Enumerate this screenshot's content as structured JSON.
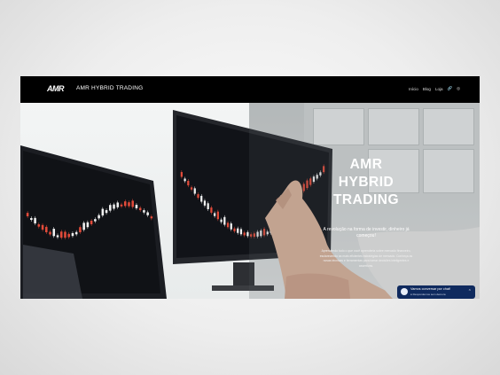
{
  "header": {
    "logo_text": "AMR",
    "site_title": "AMR HYBRID TRADING",
    "nav_items": [
      "Início",
      "Blog",
      "Loja"
    ],
    "nav_icons": [
      "link-icon",
      "instagram-icon"
    ]
  },
  "hero": {
    "title_lines": [
      "AMR",
      "HYBRID",
      "TRADING"
    ],
    "subtitle": "A revolução na forma de investir, dinheiro já começou!",
    "body": "Aprendendo tudo o que você aprenderia sobre mercado financeiro, esclarecendo as mais eficientes estratégias de mercado. Conheça as novas técnicas e ferramentas para tomar decisões inteligentes e assertivas."
  },
  "chat_widget": {
    "title": "Vamos conversar por chat!",
    "status": "● Respondemos sem demora",
    "accent": "#0f2a5e"
  },
  "colors": {
    "nav_bg": "#000000",
    "candle_up": "#e24b3a",
    "candle_down": "#f2f2f2",
    "screen_bg": "#121418"
  }
}
